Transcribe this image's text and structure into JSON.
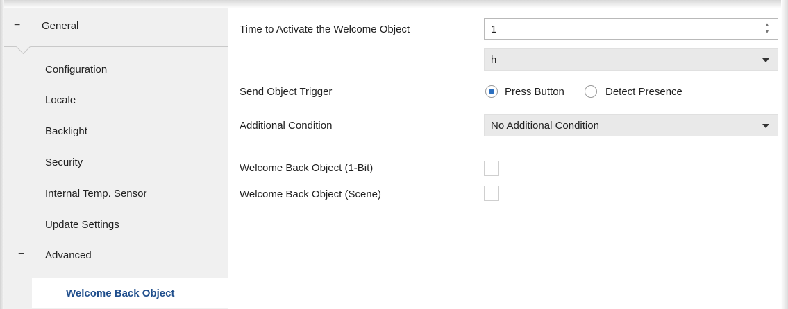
{
  "sidebar": {
    "section_general": "General",
    "items": [
      {
        "label": "Configuration"
      },
      {
        "label": "Locale"
      },
      {
        "label": "Backlight"
      },
      {
        "label": "Security"
      },
      {
        "label": "Internal Temp. Sensor"
      },
      {
        "label": "Update Settings"
      }
    ],
    "section_advanced": "Advanced",
    "active_item": "Welcome Back Object",
    "collapse_glyph": "−"
  },
  "main": {
    "time_label": "Time to Activate the Welcome Object",
    "time_value": "1",
    "time_unit": "h",
    "trigger_label": "Send Object Trigger",
    "trigger_options": [
      "Press Button",
      "Detect Presence"
    ],
    "trigger_selected": "Press Button",
    "condition_label": "Additional Condition",
    "condition_value": "No Additional Condition",
    "obj_1bit_label": "Welcome Back Object (1-Bit)",
    "obj_1bit_checked": false,
    "obj_scene_label": "Welcome Back Object (Scene)",
    "obj_scene_checked": false
  },
  "colors": {
    "accent": "#1f4e8c",
    "radio_selected": "#2c6fbf",
    "sidebar_bg": "#f0f0f0",
    "select_bg": "#e9e9e9"
  }
}
